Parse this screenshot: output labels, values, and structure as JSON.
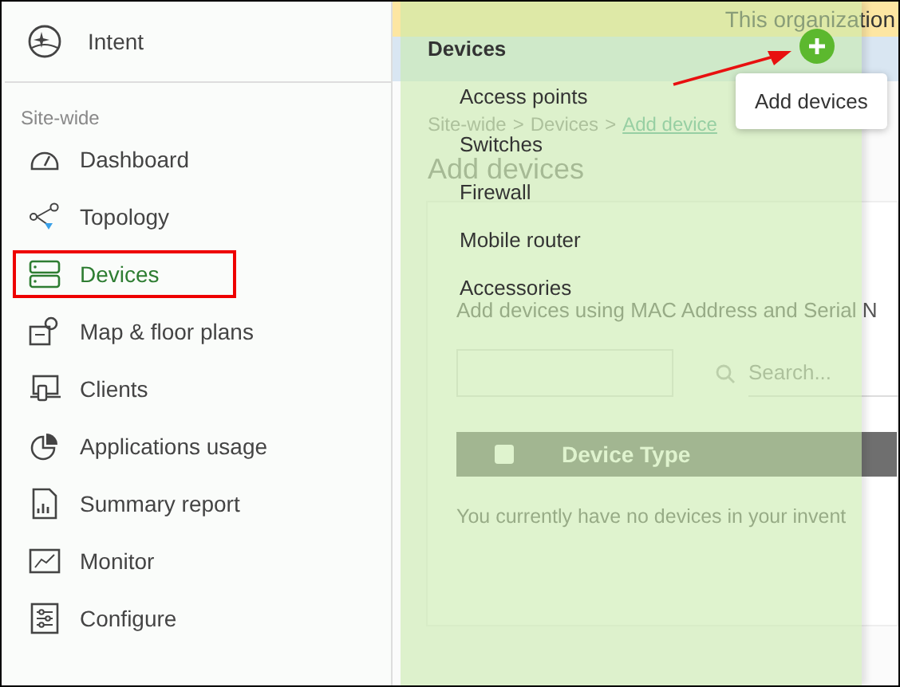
{
  "sidebar": {
    "header": {
      "label": "Intent"
    },
    "section_title": "Site-wide",
    "items": [
      {
        "label": "Dashboard",
        "selected": false
      },
      {
        "label": "Topology",
        "selected": false
      },
      {
        "label": "Devices",
        "selected": true
      },
      {
        "label": "Map & floor plans",
        "selected": false
      },
      {
        "label": "Clients",
        "selected": false
      },
      {
        "label": "Applications usage",
        "selected": false
      },
      {
        "label": "Summary report",
        "selected": false
      },
      {
        "label": "Monitor",
        "selected": false
      },
      {
        "label": "Configure",
        "selected": false
      }
    ]
  },
  "background_page": {
    "banner": "This organization",
    "breadcrumb": {
      "separator": ">",
      "items": [
        "Site-wide",
        "Devices",
        "Add device"
      ]
    },
    "heading": "Add devices",
    "card": {
      "instruction": "Add devices using MAC Address and Serial N",
      "search": {
        "placeholder": "Search..."
      },
      "table": {
        "select_all": {
          "checked": false
        },
        "columns": [
          "Device Type"
        ]
      },
      "empty_message": "You currently have no devices in your invent"
    }
  },
  "flyout": {
    "title": "Devices",
    "items": [
      "Access points",
      "Switches",
      "Firewall",
      "Mobile router",
      "Accessories"
    ]
  },
  "add_button": {
    "tooltip": "Add devices"
  }
}
